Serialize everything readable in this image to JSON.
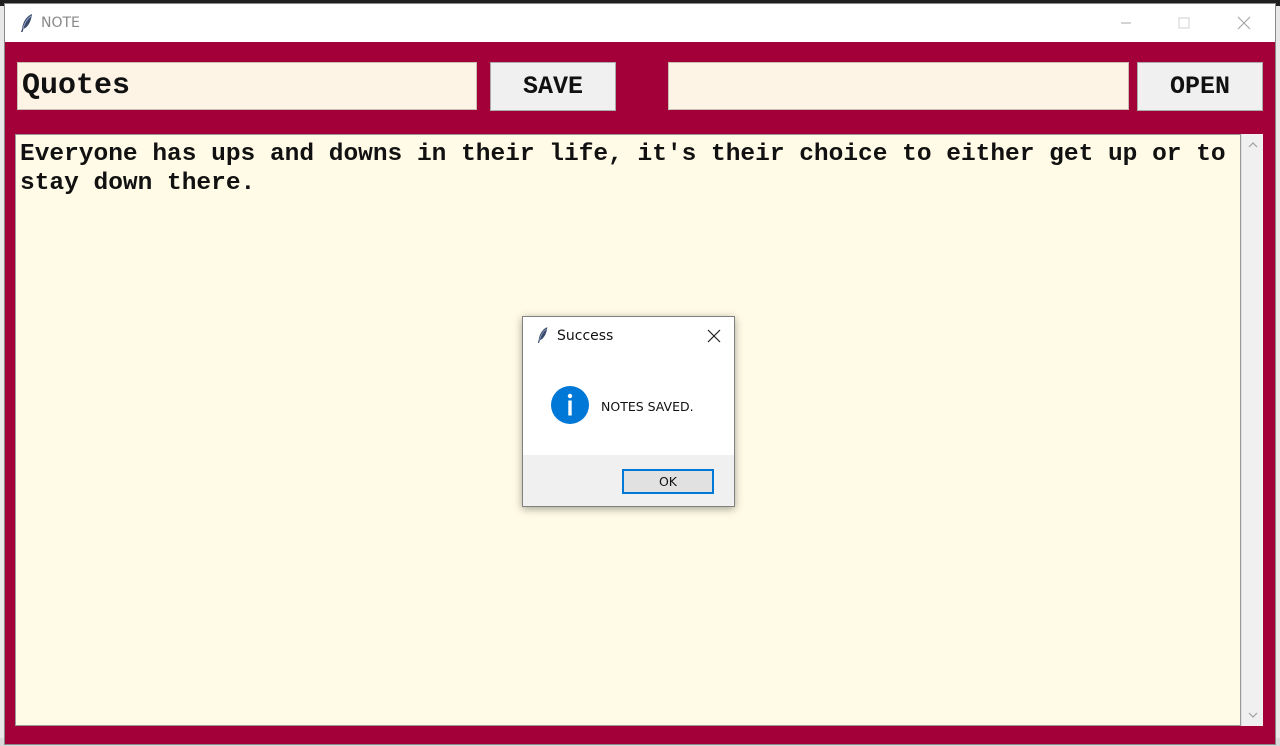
{
  "window": {
    "title": "NOTE",
    "minimize_icon": "minimize-icon",
    "maximize_icon": "maximize-icon",
    "close_icon": "close-icon",
    "background_color": "#a3003a"
  },
  "toolbar": {
    "note_name_value": "Quotes",
    "save_label": "SAVE",
    "open_file_value": "",
    "open_label": "OPEN"
  },
  "editor": {
    "content": "Everyone has ups and downs in their life, it's their choice to either get up or to stay down there."
  },
  "dialog": {
    "title": "Success",
    "message": "NOTES SAVED.",
    "ok_label": "OK",
    "icon": "info-icon",
    "accent_color": "#0078d7"
  }
}
